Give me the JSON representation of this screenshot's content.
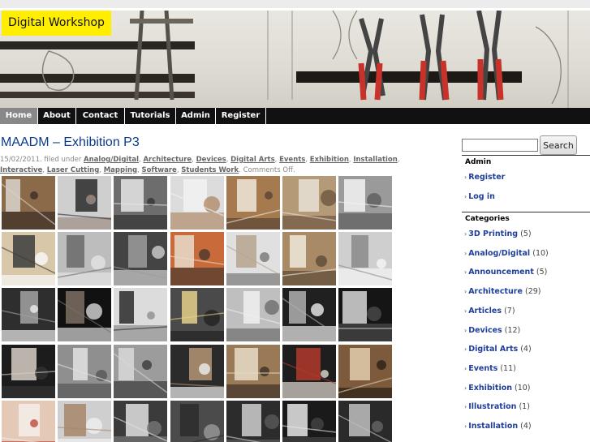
{
  "site": {
    "title": "Digital Workshop"
  },
  "nav": [
    {
      "label": "Home",
      "active": true
    },
    {
      "label": "About"
    },
    {
      "label": "Contact"
    },
    {
      "label": "Tutorials"
    },
    {
      "label": "Admin"
    },
    {
      "label": "Register"
    }
  ],
  "post": {
    "title": "MAADM – Exhibition P3",
    "date": "15/02/2011",
    "filed_under": "filed under",
    "categories": [
      "Analog/Digital",
      "Architecture",
      "Devices",
      "Digital Arts",
      "Events",
      "Exhibition",
      "Installation",
      "Interactive",
      "Laser Cutting",
      "Mapping",
      "Software",
      "Students Work"
    ],
    "comments": "Comments Off"
  },
  "search": {
    "value": "",
    "button_label": "Search"
  },
  "sidebar": {
    "admin_title": "Admin",
    "admin_links": [
      "Register",
      "Log in"
    ],
    "categories_title": "Categories",
    "categories": [
      {
        "name": "3D Printing",
        "count": "(5)"
      },
      {
        "name": "Analog/Digital",
        "count": "(10)"
      },
      {
        "name": "Announcement",
        "count": "(5)"
      },
      {
        "name": "Architecture",
        "count": "(29)"
      },
      {
        "name": "Articles",
        "count": "(7)"
      },
      {
        "name": "Devices",
        "count": "(12)"
      },
      {
        "name": "Digital Arts",
        "count": "(4)"
      },
      {
        "name": "Events",
        "count": "(11)"
      },
      {
        "name": "Exhibition",
        "count": "(10)"
      },
      {
        "name": "Illustration",
        "count": "(1)"
      },
      {
        "name": "Installation",
        "count": "(4)"
      }
    ]
  },
  "colors": {
    "title_yellow": "#ffee00",
    "nav_bg": "#111111",
    "link_blue": "#1f3f9a"
  }
}
